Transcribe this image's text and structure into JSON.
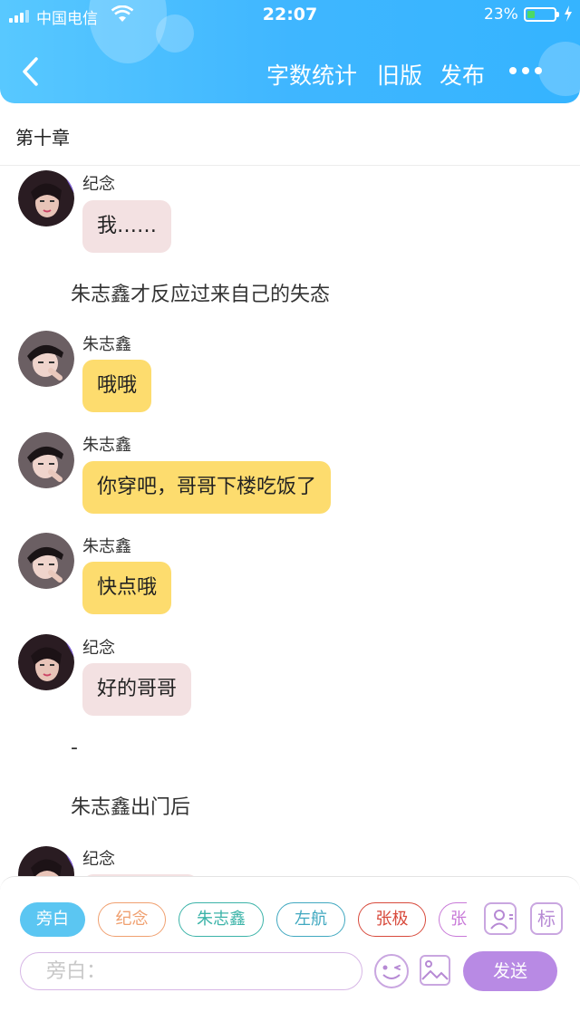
{
  "status_bar": {
    "carrier": "中国电信",
    "time": "22:07",
    "battery": "23%"
  },
  "nav": {
    "word_count": "字数统计",
    "old_version": "旧版",
    "publish": "发布"
  },
  "chapter_title": "第十章",
  "messages": [
    {
      "type": "chat",
      "sender": "纪念",
      "text": "我……"
    },
    {
      "type": "narration",
      "text": "朱志鑫才反应过来自己的失态"
    },
    {
      "type": "chat",
      "sender": "朱志鑫",
      "text": "哦哦"
    },
    {
      "type": "chat",
      "sender": "朱志鑫",
      "text": "你穿吧，哥哥下楼吃饭了"
    },
    {
      "type": "chat",
      "sender": "朱志鑫",
      "text": "快点哦"
    },
    {
      "type": "chat",
      "sender": "纪念",
      "text": "好的哥哥"
    },
    {
      "type": "narration",
      "text": "-"
    },
    {
      "type": "narration",
      "text": "朱志鑫出门后"
    },
    {
      "type": "chat",
      "sender": "纪念",
      "text": ""
    }
  ],
  "roles": [
    "旁白",
    "纪念",
    "朱志鑫",
    "左航",
    "张极",
    "张"
  ],
  "side_buttons": {
    "mark": "标"
  },
  "input": {
    "placeholder": "旁白："
  },
  "send_label": "发送",
  "colors": {
    "header": "#3fb6ff",
    "bubble_female": "#f3e1e2",
    "bubble_male": "#fddc6e",
    "send_button": "#b88ae4"
  },
  "icons": [
    "back-arrow-icon",
    "more-dots-icon",
    "wifi-icon",
    "battery-icon",
    "emoji-icon",
    "image-icon",
    "role-card-icon"
  ]
}
